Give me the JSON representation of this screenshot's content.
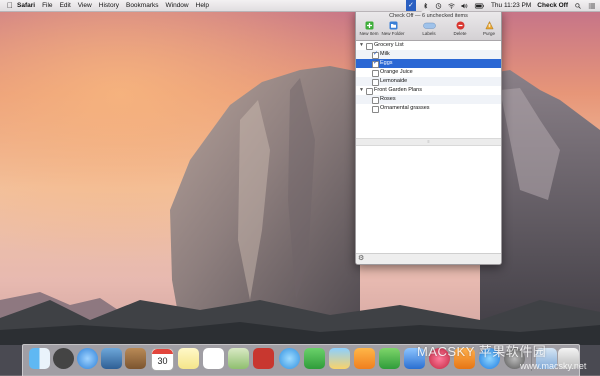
{
  "menubar": {
    "app_name": "Safari",
    "menus": [
      "File",
      "Edit",
      "View",
      "History",
      "Bookmarks",
      "Window",
      "Help"
    ],
    "status_icons": [
      "bluetooth-icon",
      "time-machine-icon",
      "volume-icon",
      "wifi-icon",
      "battery-icon",
      "checkoff-icon"
    ],
    "clock": "Thu 11:23 PM",
    "user": "Check Off"
  },
  "popover": {
    "title": "Check Off — 6 unchecked items",
    "toolbar": [
      {
        "label": "New Item",
        "icon": "new-item-icon"
      },
      {
        "label": "New Folder",
        "icon": "new-folder-icon"
      },
      {
        "label": "Labels",
        "icon": "labels-icon"
      },
      {
        "label": "Delete",
        "icon": "delete-icon"
      },
      {
        "label": "Purge",
        "icon": "purge-icon"
      }
    ],
    "items": [
      {
        "type": "folder",
        "label": "Grocery List",
        "checked": false
      },
      {
        "type": "item",
        "label": "Milk",
        "checked": true
      },
      {
        "type": "item",
        "label": "Eggs",
        "checked": true,
        "selected": true
      },
      {
        "type": "item",
        "label": "Orange Juice",
        "checked": false
      },
      {
        "type": "item",
        "label": "Lemonaide",
        "checked": false
      },
      {
        "type": "folder",
        "label": "Front Garden Plans",
        "checked": false
      },
      {
        "type": "item",
        "label": "Roses",
        "checked": false
      },
      {
        "type": "item",
        "label": "Ornamental grasses",
        "checked": false
      }
    ]
  },
  "dock": {
    "calendar_day": "30",
    "apps": [
      "finder-icon",
      "launchpad-icon",
      "safari-icon",
      "preview-icon",
      "contacts-icon",
      "calendar-icon",
      "notes-icon",
      "reminders-icon",
      "maps-icon",
      "photo-booth-icon",
      "messages-icon",
      "facetime-icon",
      "photos-icon",
      "pages-icon",
      "numbers-icon",
      "keynote-icon",
      "itunes-icon",
      "ibooks-icon",
      "app-store-icon",
      "system-preferences-icon",
      "downloads-icon",
      "trash-icon"
    ]
  },
  "watermark": {
    "brand": "MACSKY 苹果软件园",
    "url": "www.macsky.net"
  },
  "colors": {
    "selection": "#2a67d4",
    "menubar": "#e9e6e9"
  }
}
